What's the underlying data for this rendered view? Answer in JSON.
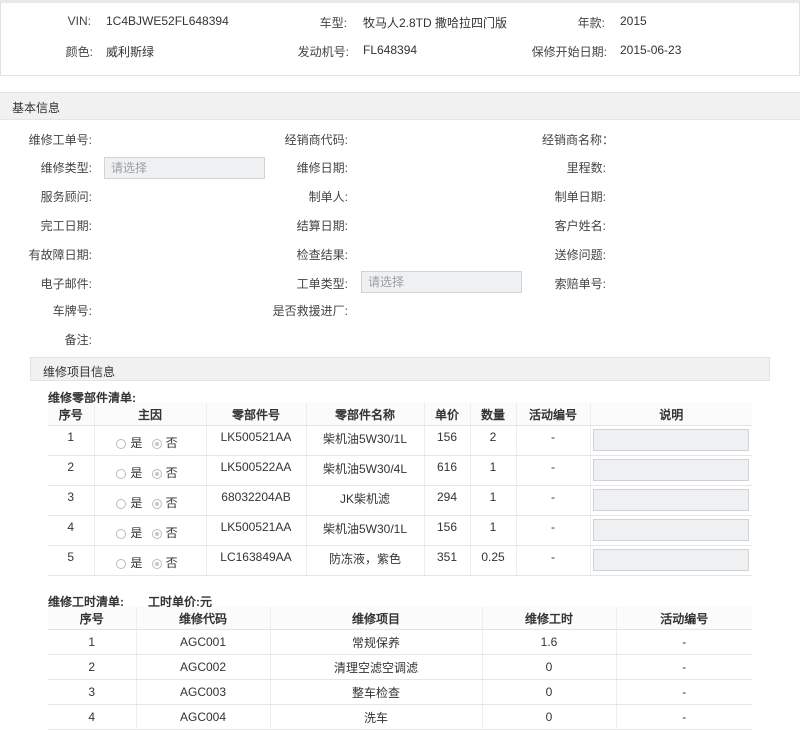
{
  "vehicle": {
    "vin_label": "VIN:",
    "vin": "1C4BJWE52FL648394",
    "model_label": "车型:",
    "model": "牧马人2.8TD 撒哈拉四门版",
    "year_label": "年款:",
    "year": "2015",
    "color_label": "颜色:",
    "color": "威利斯绿",
    "engine_label": "发动机号:",
    "engine": "FL648394",
    "warranty_label": "保修开始日期:",
    "warranty_date": "2015-06-23"
  },
  "basic": {
    "title": "基本信息",
    "fields": {
      "repair_order_no": "维修工单号:",
      "dealer_code": "经销商代码:",
      "dealer_name": "经销商名称：",
      "repair_type": "维修类型:",
      "repair_type_placeholder": "请选择",
      "repair_date": "维修日期:",
      "mileage": "里程数:",
      "service_advisor": "服务顾问:",
      "creator": "制单人:",
      "create_date": "制单日期:",
      "finish_date": "完工日期:",
      "settle_date": "结算日期:",
      "customer_name": "客户姓名:",
      "fault_date": "有故障日期:",
      "inspection": "检查结果:",
      "repair_issue": "送修问题:",
      "email": "电子邮件:",
      "order_type": "工单类型:",
      "order_type_placeholder": "请选择",
      "claim_no": "索赔单号:",
      "plate": "车牌号:",
      "rescue": "是否救援进厂:",
      "remark": "备注:"
    }
  },
  "repair": {
    "title": "维修项目信息",
    "parts_title": "维修零部件清单:",
    "parts_headers": [
      "序号",
      "主因",
      "零部件号",
      "零部件名称",
      "单价",
      "数量",
      "活动编号",
      "说明"
    ],
    "yes_label": "是",
    "no_label": "否",
    "parts": [
      {
        "no": "1",
        "part_no": "LK500521AA",
        "name": "柴机油5W30/1L",
        "price": "156",
        "qty": "2",
        "activity": "-"
      },
      {
        "no": "2",
        "part_no": "LK500522AA",
        "name": "柴机油5W30/4L",
        "price": "616",
        "qty": "1",
        "activity": "-"
      },
      {
        "no": "3",
        "part_no": "68032204AB",
        "name": "JK柴机滤",
        "price": "294",
        "qty": "1",
        "activity": "-"
      },
      {
        "no": "4",
        "part_no": "LK500521AA",
        "name": "柴机油5W30/1L",
        "price": "156",
        "qty": "1",
        "activity": "-"
      },
      {
        "no": "5",
        "part_no": "LC163849AA",
        "name": "防冻液，紫色",
        "price": "351",
        "qty": "0.25",
        "activity": "-"
      }
    ],
    "labor_title": "维修工时清单:",
    "labor_unit_price": "工时单价:元",
    "labor_headers": [
      "序号",
      "维修代码",
      "维修项目",
      "维修工时",
      "活动编号"
    ],
    "labor": [
      {
        "no": "1",
        "code": "AGC001",
        "item": "常规保养",
        "hours": "1.6",
        "activity": "-"
      },
      {
        "no": "2",
        "code": "AGC002",
        "item": "清理空滤空调滤",
        "hours": "0",
        "activity": "-"
      },
      {
        "no": "3",
        "code": "AGC003",
        "item": "整车检查",
        "hours": "0",
        "activity": "-"
      },
      {
        "no": "4",
        "code": "AGC004",
        "item": "洗车",
        "hours": "0",
        "activity": "-"
      }
    ]
  }
}
